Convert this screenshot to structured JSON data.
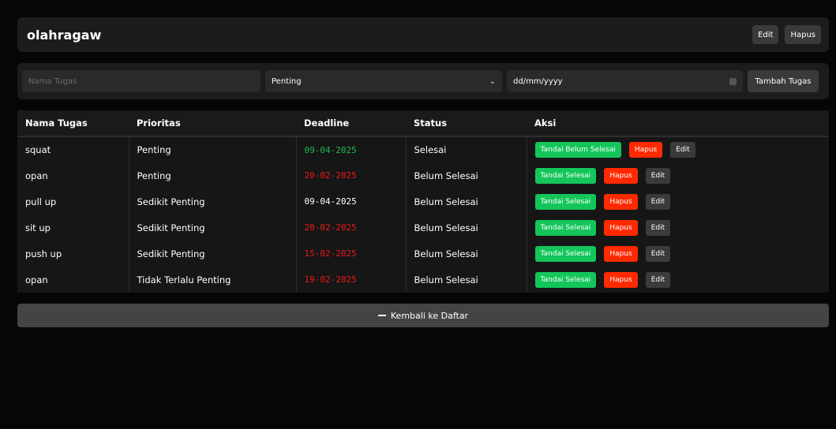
{
  "header": {
    "title": "olahragaw",
    "edit_label": "Edit",
    "delete_label": "Hapus"
  },
  "form": {
    "name_placeholder": "Nama Tugas",
    "priority_selected": "Penting",
    "date_placeholder": "dd/mm/yyyy",
    "add_label": "Tambah Tugas"
  },
  "table": {
    "columns": [
      "Nama Tugas",
      "Prioritas",
      "Deadline",
      "Status",
      "Aksi"
    ],
    "rows": [
      {
        "name": "squat",
        "priority": "Penting",
        "deadline": "09-04-2025",
        "deadline_color": "#22b84a",
        "status": "Selesai",
        "toggle_label": "Tandai Belum Selesai",
        "delete_label": "Hapus",
        "edit_label": "Edit"
      },
      {
        "name": "opan",
        "priority": "Penting",
        "deadline": "20-02-2025",
        "deadline_color": "#f01818",
        "status": "Belum Selesai",
        "toggle_label": "Tandai Selesai",
        "delete_label": "Hapus",
        "edit_label": "Edit"
      },
      {
        "name": "pull up",
        "priority": "Sedikit Penting",
        "deadline": "09-04-2025",
        "deadline_color": "#ffffff",
        "status": "Belum Selesai",
        "toggle_label": "Tandai Selesai",
        "delete_label": "Hapus",
        "edit_label": "Edit"
      },
      {
        "name": "sit up",
        "priority": "Sedikit Penting",
        "deadline": "20-02-2025",
        "deadline_color": "#f01818",
        "status": "Belum Selesai",
        "toggle_label": "Tandai Selesai",
        "delete_label": "Hapus",
        "edit_label": "Edit"
      },
      {
        "name": "push up",
        "priority": "Sedikit Penting",
        "deadline": "15-02-2025",
        "deadline_color": "#f01818",
        "status": "Belum Selesai",
        "toggle_label": "Tandai Selesai",
        "delete_label": "Hapus",
        "edit_label": "Edit"
      },
      {
        "name": "opan",
        "priority": "Tidak Terlalu Penting",
        "deadline": "19-02-2025",
        "deadline_color": "#f01818",
        "status": "Belum Selesai",
        "toggle_label": "Tandai Selesai",
        "delete_label": "Hapus",
        "edit_label": "Edit"
      }
    ]
  },
  "back_label": "Kembali ke Daftar",
  "colors": {
    "green_button": "#14c65a",
    "red_button": "#ff2a00",
    "gray_button": "#3b3b3b",
    "panel": "#1c1c1c"
  }
}
